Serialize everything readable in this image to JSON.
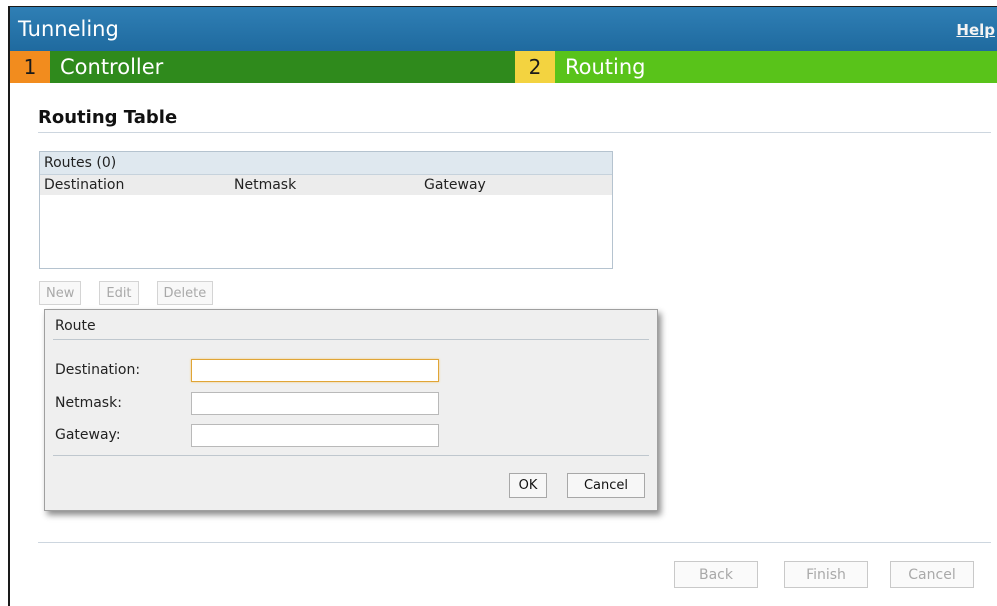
{
  "header": {
    "title": "Tunneling",
    "help_label": "Help"
  },
  "steps": [
    {
      "number": "1",
      "label": "Controller"
    },
    {
      "number": "2",
      "label": "Routing"
    }
  ],
  "section": {
    "heading": "Routing Table"
  },
  "routes_table": {
    "caption": "Routes (0)",
    "columns": [
      "Destination",
      "Netmask",
      "Gateway"
    ],
    "rows": []
  },
  "table_actions": {
    "new_label": "New",
    "edit_label": "Edit",
    "delete_label": "Delete"
  },
  "route_dialog": {
    "title": "Route",
    "destination_label": "Destination:",
    "destination_value": "",
    "netmask_label": "Netmask:",
    "netmask_value": "",
    "gateway_label": "Gateway:",
    "gateway_value": "",
    "ok_label": "OK",
    "cancel_label": "Cancel"
  },
  "footer": {
    "back_label": "Back",
    "finish_label": "Finish",
    "cancel_label": "Cancel"
  },
  "colors": {
    "title_bar": "#2176ae",
    "step1_active": "#2f8a1c",
    "step1_number": "#f28c1e",
    "step2_current": "#59c31a",
    "step2_number": "#f3d340"
  }
}
